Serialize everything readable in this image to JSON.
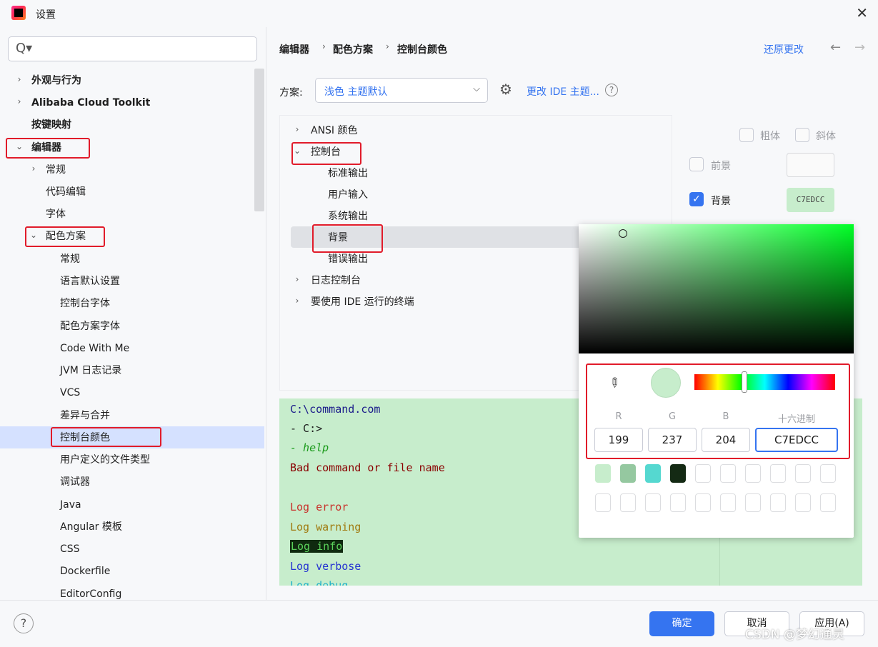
{
  "window": {
    "title": "设置",
    "close": "✕"
  },
  "search": {
    "placeholder": "",
    "icon": "Q▾"
  },
  "tree": {
    "items": [
      {
        "label": "外观与行为",
        "chev": "›"
      },
      {
        "label": "Alibaba Cloud Toolkit",
        "chev": "›"
      },
      {
        "label": "按键映射"
      },
      {
        "label": "编辑器",
        "chev": "⌄"
      },
      {
        "label": "常规",
        "chev": "›"
      },
      {
        "label": "代码编辑"
      },
      {
        "label": "字体"
      },
      {
        "label": "配色方案",
        "chev": "⌄"
      },
      {
        "label": "常规"
      },
      {
        "label": "语言默认设置"
      },
      {
        "label": "控制台字体"
      },
      {
        "label": "配色方案字体"
      },
      {
        "label": "Code With Me"
      },
      {
        "label": "JVM 日志记录"
      },
      {
        "label": "VCS"
      },
      {
        "label": "差异与合并"
      },
      {
        "label": "控制台颜色"
      },
      {
        "label": "用户定义的文件类型"
      },
      {
        "label": "调试器"
      },
      {
        "label": "Java"
      },
      {
        "label": "Angular 模板"
      },
      {
        "label": "CSS"
      },
      {
        "label": "Dockerfile"
      },
      {
        "label": "EditorConfig"
      }
    ]
  },
  "breadcrumb": {
    "items": [
      "编辑器",
      "配色方案",
      "控制台颜色"
    ],
    "sep": "›"
  },
  "header": {
    "restore": "还原更改",
    "back": "←",
    "forward": "→"
  },
  "scheme": {
    "label": "方案:",
    "value": "浅色 主题默认",
    "caret": "⌵",
    "change_ide": "更改 IDE 主题...",
    "help": "?",
    "gear": "⚙"
  },
  "mid_tree": {
    "items": [
      {
        "label": "ANSI 颜色",
        "chev": "›"
      },
      {
        "label": "控制台",
        "chev": "⌄"
      },
      {
        "label": "标准输出"
      },
      {
        "label": "用户输入"
      },
      {
        "label": "系统输出"
      },
      {
        "label": "背景"
      },
      {
        "label": "错误输出"
      },
      {
        "label": "日志控制台",
        "chev": "›"
      },
      {
        "label": "要使用 IDE 运行的终端",
        "chev": "›"
      }
    ]
  },
  "attributes": {
    "bold": "粗体",
    "italic": "斜体",
    "foreground": "前景",
    "background": "背景",
    "bg_hex": "C7EDCC",
    "check": "✓"
  },
  "preview": {
    "lines": [
      {
        "text": "C:\\command.com",
        "color": "#1a1a8a"
      },
      {
        "text": "- C:>",
        "color": "#1f1f1f"
      },
      {
        "text": "- help",
        "color": "#1a9a1a"
      },
      {
        "text": "Bad command or file name",
        "color": "#8a0000"
      },
      {
        "text": "",
        "color": "#1f1f1f"
      },
      {
        "text": "Log error",
        "color": "#c8312b"
      },
      {
        "text": "Log warning",
        "color": "#a07a10"
      },
      {
        "text": "Log info",
        "color": "#5ad15a"
      },
      {
        "text": "Log verbose",
        "color": "#2633d1"
      },
      {
        "text": "Log debug",
        "color": "#20b2c8"
      }
    ]
  },
  "picker": {
    "r_label": "R",
    "g_label": "G",
    "b_label": "B",
    "hex_label": "十六进制",
    "r": "199",
    "g": "237",
    "b": "204",
    "hex": "C7EDCC",
    "eyedropper": "✎",
    "palette": [
      "#c7edcc",
      "#95c8a0",
      "#55d8d0",
      "#142a14"
    ]
  },
  "footer": {
    "help": "?",
    "ok": "确定",
    "cancel": "取消",
    "apply": "应用(A)"
  },
  "watermark": "CSDN @梦幻通灵"
}
